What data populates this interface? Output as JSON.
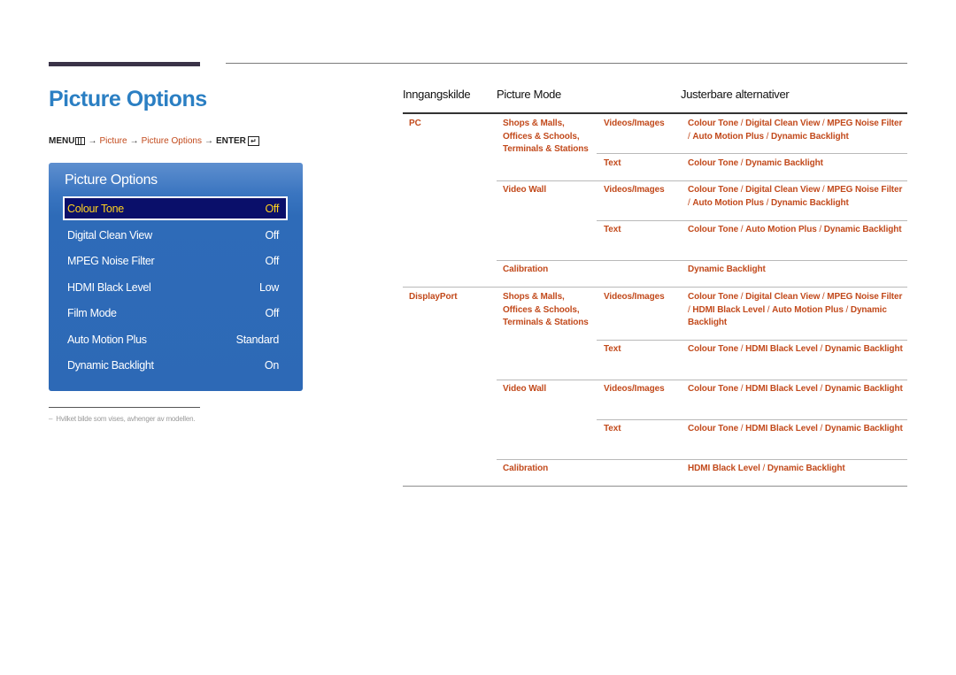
{
  "page": {
    "title": "Picture Options",
    "menu_path": {
      "menu_key": "MENU",
      "menu_icon": "menu-grid-icon",
      "arrow": "→",
      "steps": [
        "Picture",
        "Picture Options"
      ],
      "enter_key": "ENTER",
      "enter_icon": "enter-return-icon"
    },
    "footnote": {
      "dash": "–",
      "text": "Hvilket bilde som vises, avhenger av modellen."
    }
  },
  "osd": {
    "title": "Picture Options",
    "items": [
      {
        "label": "Colour Tone",
        "value": "Off",
        "selected": true
      },
      {
        "label": "Digital Clean View",
        "value": "Off",
        "selected": false
      },
      {
        "label": "MPEG Noise Filter",
        "value": "Off",
        "selected": false
      },
      {
        "label": "HDMI Black Level",
        "value": "Low",
        "selected": false
      },
      {
        "label": "Film Mode",
        "value": "Off",
        "selected": false
      },
      {
        "label": "Auto Motion Plus",
        "value": "Standard",
        "selected": false
      },
      {
        "label": "Dynamic Backlight",
        "value": "On",
        "selected": false
      }
    ]
  },
  "table": {
    "headers": {
      "source": "Inngangskilde",
      "mode": "Picture Mode",
      "options": "Justerbare alternativer"
    },
    "separator": "/",
    "rows": [
      {
        "source": "PC",
        "mode": "Shops & Malls, Offices & Schools, Terminals & Stations",
        "sub": "Videos/Images",
        "options": [
          "Colour Tone",
          "Digital Clean View",
          "MPEG Noise Filter",
          "Auto Motion Plus",
          "Dynamic Backlight"
        ]
      },
      {
        "source": "",
        "mode": "",
        "sub": "Text",
        "options": [
          "Colour Tone",
          "Dynamic Backlight"
        ]
      },
      {
        "source": "",
        "mode": "Video Wall",
        "sub": "Videos/Images",
        "options": [
          "Colour Tone",
          "Digital Clean View",
          "MPEG Noise Filter",
          "Auto Motion Plus",
          "Dynamic Backlight"
        ]
      },
      {
        "source": "",
        "mode": "",
        "sub": "Text",
        "options": [
          "Colour Tone",
          "Auto Motion Plus",
          "Dynamic Backlight"
        ]
      },
      {
        "source": "",
        "mode": "Calibration",
        "sub": "",
        "options": [
          "Dynamic Backlight"
        ]
      },
      {
        "source": "DisplayPort",
        "mode": "Shops & Malls, Offices & Schools, Terminals & Stations",
        "sub": "Videos/Images",
        "options": [
          "Colour Tone",
          "Digital Clean View",
          "MPEG Noise Filter",
          "HDMI Black Level",
          "Auto Motion Plus",
          "Dynamic Backlight"
        ]
      },
      {
        "source": "",
        "mode": "",
        "sub": "Text",
        "options": [
          "Colour Tone",
          "HDMI Black Level",
          "Dynamic Backlight"
        ]
      },
      {
        "source": "",
        "mode": "Video Wall",
        "sub": "Videos/Images",
        "options": [
          "Colour Tone",
          "HDMI Black Level",
          "Dynamic Backlight"
        ]
      },
      {
        "source": "",
        "mode": "",
        "sub": "Text",
        "options": [
          "Colour Tone",
          "HDMI Black Level",
          "Dynamic Backlight"
        ]
      },
      {
        "source": "",
        "mode": "Calibration",
        "sub": "",
        "options": [
          "HDMI Black Level",
          "Dynamic Backlight"
        ]
      }
    ]
  },
  "colors": {
    "title_blue": "#2b7fc3",
    "link_orange": "#c24a1c",
    "osd_blue": "#2d69b6",
    "osd_selected_bg": "#0a0f6a",
    "osd_selected_text": "#ffd21f"
  }
}
